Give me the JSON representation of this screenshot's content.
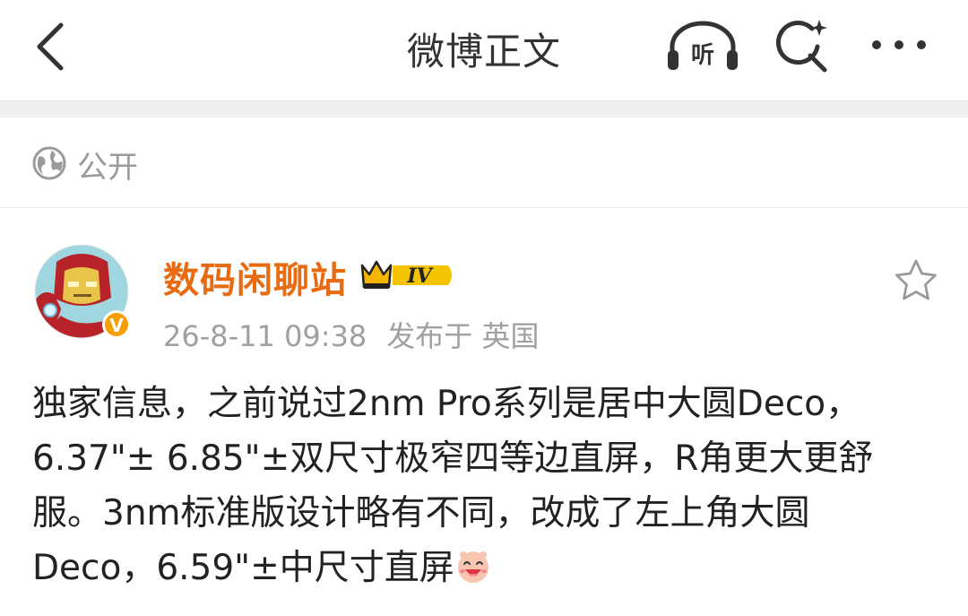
{
  "header": {
    "title": "微博正文",
    "listen_label": "听",
    "icons": {
      "back": "back-arrow-icon",
      "listen": "headphones-listen-icon",
      "search": "search-sparkle-icon",
      "more": "more-dots-icon"
    }
  },
  "visibility": {
    "icon": "globe-icon",
    "label": "公开"
  },
  "post": {
    "author": {
      "name": "数码闲聊站",
      "badge_level": "IV",
      "verified_badge": "V",
      "avatar_icon": "ironman-avatar"
    },
    "time": "26-8-11 09:38",
    "source": "发布于 英国",
    "text": [
      "独家信息，之前说过2nm Pro系列是居中大圆Deco，",
      "6.37\"± 6.85\"±双尺寸极窄四等边直屏，R角更大更舒",
      "服。3nm标准版设计略有不同，改成了左上角大圆",
      "Deco，6.59\"±中尺寸直屏"
    ],
    "emoji": "laughing-emoji",
    "favorite_icon": "star-outline-icon"
  },
  "colors": {
    "accent_orange": "#e86b12",
    "gold_badge": "#f5b400",
    "text_gray": "#a0a0a0"
  }
}
